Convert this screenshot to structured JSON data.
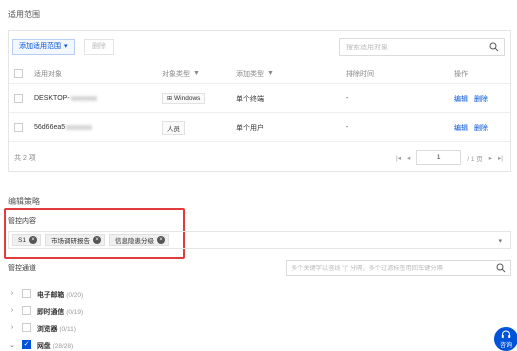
{
  "scope": {
    "title": "适用范围",
    "toolbar": {
      "add_label": "添加适用范围",
      "delete_label": "删除"
    },
    "search": {
      "placeholder": "搜索适用对象"
    },
    "columns": [
      "适用对象",
      "对象类型",
      "添加类型",
      "排除时间",
      "操作"
    ],
    "rows": [
      {
        "target": "DESKTOP-",
        "type": "Windows",
        "add_type": "单个终端",
        "exclude": "-",
        "actions": [
          "编辑",
          "删除"
        ]
      },
      {
        "target": "56d66ea5",
        "type": "人员",
        "add_type": "单个用户",
        "exclude": "-",
        "actions": [
          "编辑",
          "删除"
        ]
      }
    ],
    "footer": {
      "total": "共 2 项",
      "page": "1",
      "pages": "/ 1 页"
    }
  },
  "policy": {
    "title": "编辑策略",
    "control_label": "管控内容",
    "chips": [
      "S1",
      "市场调研报告",
      "信息隐患分级"
    ],
    "channel_label": "管控通道",
    "channel_search_placeholder": "多个关键字以竖线 \"|\" 分隔，多个过滤标签用回车键分隔",
    "channels": [
      {
        "name": "电子邮箱",
        "count": "(0/20)",
        "checked": false,
        "expanded": false
      },
      {
        "name": "即时通信",
        "count": "(0/19)",
        "checked": false,
        "expanded": false
      },
      {
        "name": "浏览器",
        "count": "(0/11)",
        "checked": false,
        "expanded": false
      },
      {
        "name": "网盘",
        "count": "(28/28)",
        "checked": true,
        "expanded": true
      }
    ]
  },
  "help": {
    "label": "咨询"
  },
  "colors": {
    "accent": "#0052d9",
    "highlight": "#e23b3b"
  },
  "icons": {
    "search": "search-icon",
    "filter": "filter-icon",
    "windows": "windows-icon",
    "chevron": "chevron-down-icon"
  }
}
